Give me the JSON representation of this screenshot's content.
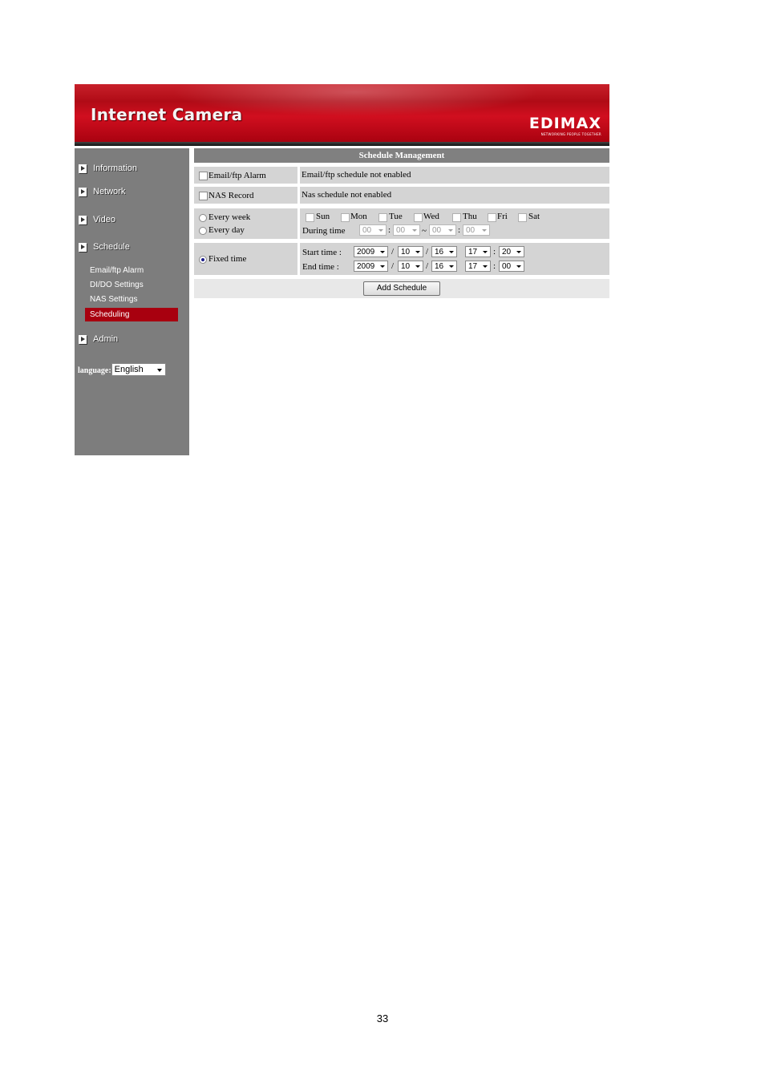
{
  "header": {
    "title": "Internet Camera",
    "brand": "EDIMAX",
    "tagline": "NETWORKING PEOPLE TOGETHER"
  },
  "sidebar": {
    "items": [
      {
        "label": "Information"
      },
      {
        "label": "Network"
      },
      {
        "label": "Video"
      },
      {
        "label": "Schedule"
      },
      {
        "label": "Admin"
      }
    ],
    "schedule_sub": [
      {
        "label": "Email/ftp Alarm"
      },
      {
        "label": "DI/DO Settings"
      },
      {
        "label": "NAS Settings"
      },
      {
        "label": "Scheduling",
        "active": true
      }
    ],
    "language_label": "language:",
    "language_value": "English"
  },
  "panel": {
    "title": "Schedule Management",
    "email_alarm": {
      "label": "Email/ftp Alarm",
      "checked": false,
      "status": "Email/ftp schedule not enabled"
    },
    "nas_record": {
      "label": "NAS Record",
      "checked": false,
      "status": "Nas schedule not enabled"
    },
    "repeat": {
      "every_week": "Every week",
      "every_day": "Every day",
      "days": [
        "Sun",
        "Mon",
        "Tue",
        "Wed",
        "Thu",
        "Fri",
        "Sat"
      ],
      "during_label": "During time",
      "during_values": [
        "00",
        "00",
        "00",
        "00"
      ],
      "sep_colon": ":",
      "sep_tilde": "~"
    },
    "fixed": {
      "label": "Fixed time",
      "selected": true,
      "start_label": "Start time :",
      "end_label": "End time :",
      "start": {
        "year": "2009",
        "month": "10",
        "day": "16",
        "hour": "17",
        "minute": "20"
      },
      "end": {
        "year": "2009",
        "month": "10",
        "day": "16",
        "hour": "17",
        "minute": "00"
      },
      "sep_slash": "/",
      "sep_colon": ":"
    },
    "add_button": "Add Schedule"
  },
  "footer": {
    "page_number": "33"
  },
  "colors": {
    "accent_red": "#a8000f",
    "sidebar_gray": "#7d7d7d",
    "panel_gray": "#d4d4d4"
  }
}
